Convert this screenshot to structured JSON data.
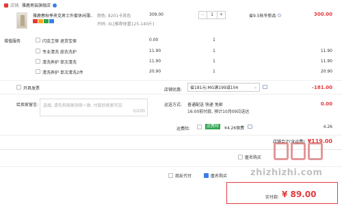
{
  "shop": {
    "prefix": "店铺:",
    "name": "雅鹿男装旗舰店"
  },
  "item": {
    "title": "雅鹿春秋季夹克男士外套休闲薄...",
    "color_label": "颜色: 8201卡其色",
    "size_label": "尺码: XL[推荐体重125-140斤]",
    "price": "309.00",
    "qty": "1",
    "promo": "省9.5秋冬新品",
    "subtotal": "300.00"
  },
  "services": {
    "label": "增值服务",
    "rows": [
      {
        "name": "闪金卫保 退货宝保",
        "price": "0.00",
        "qty": "1",
        "total": ""
      },
      {
        "name": "专业清洗 皮衣洗护",
        "price": "11.90",
        "qty": "1",
        "total": "11.90"
      },
      {
        "name": "清洗养护 单次清洗",
        "price": "11.90",
        "qty": "1",
        "total": "11.90"
      },
      {
        "name": "清洗养护 单次清洗2件",
        "price": "20.90",
        "qty": "1",
        "total": "20.90"
      }
    ]
  },
  "invoice": {
    "label": "开具发票"
  },
  "coupon": {
    "label": "店铺优惠:",
    "value": "省181元:MG满199减104",
    "amount": "-181.00"
  },
  "message": {
    "label": "给卖家留言:",
    "placeholder": "选填, 请先和商家协商一致, 付款后商家可见",
    "counter": "0/200"
  },
  "shipping": {
    "label": "运送方式:",
    "line1": "普通配送 快递 免邮",
    "line2": "16:00前付款, 预计10月09日送达",
    "amount": "0.00"
  },
  "insurance": {
    "label": "运费险:",
    "badge": "运费险",
    "text": "¥4.26保费",
    "amount": "4.26"
  },
  "store_total": {
    "label": "店铺合计(含运费)",
    "amount": "¥119.00"
  },
  "footer": {
    "anon_label": "匿名购买",
    "opt1": "朋友代付",
    "opt2": "匿名购买",
    "paid_label": "实付款:",
    "paid_amount": "¥ 89.00"
  },
  "watermark": "zhizhizhi.com"
}
